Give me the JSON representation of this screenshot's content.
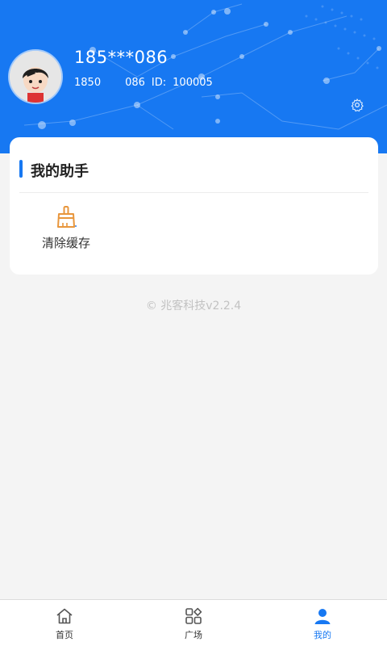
{
  "profile": {
    "phone": "185***086",
    "sub_prefix": "1850",
    "sub_suffix": "086",
    "id_label": "ID:",
    "id_value": "100005"
  },
  "assistant": {
    "title": "我的助手",
    "tools": [
      {
        "label": "清除缓存",
        "icon": "broom-icon"
      }
    ]
  },
  "footer": {
    "copyright": "© 兆客科技v2.2.4"
  },
  "tabbar": {
    "tabs": [
      {
        "label": "首页",
        "icon": "home-icon",
        "active": false
      },
      {
        "label": "广场",
        "icon": "grid-icon",
        "active": false
      },
      {
        "label": "我的",
        "icon": "user-icon",
        "active": true
      }
    ]
  },
  "colors": {
    "primary": "#1778f2",
    "tool_icon": "#e8963c"
  }
}
